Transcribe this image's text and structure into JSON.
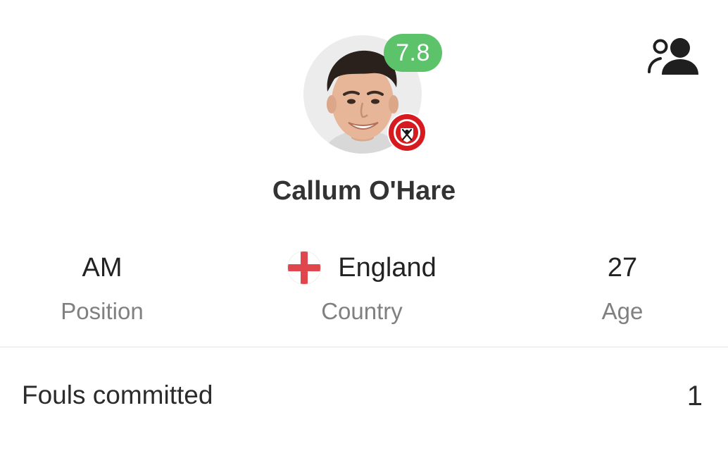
{
  "player": {
    "name": "Callum O'Hare",
    "rating": "7.8",
    "rating_color": "#5cc36b",
    "club_colors": {
      "primary": "#d71920",
      "secondary": "#1a1a1a"
    }
  },
  "header": {
    "compare_icon": "people-compare-icon"
  },
  "info": {
    "position": {
      "value": "AM",
      "label": "Position"
    },
    "country": {
      "value": "England",
      "label": "Country",
      "flag_icon": "england-flag-icon"
    },
    "age": {
      "value": "27",
      "label": "Age"
    }
  },
  "stats": [
    {
      "label": "Fouls committed",
      "value": "1"
    }
  ]
}
